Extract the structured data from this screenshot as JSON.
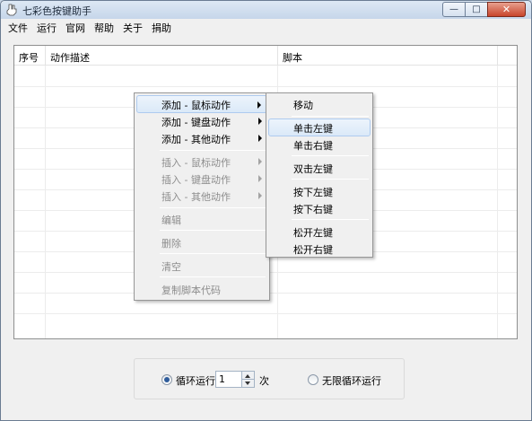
{
  "window": {
    "title": "七彩色按键助手",
    "controls": {
      "minimize": "—",
      "maximize": "□",
      "close": "✕"
    }
  },
  "menubar": [
    "文件",
    "运行",
    "官网",
    "帮助",
    "关于",
    "捐助"
  ],
  "grid": {
    "columns": [
      "序号",
      "动作描述",
      "脚本"
    ],
    "rows": []
  },
  "context_menu": {
    "items": [
      {
        "label": "添加 - 鼠标动作",
        "enabled": true,
        "submenu": true,
        "highlighted": true
      },
      {
        "label": "添加 - 键盘动作",
        "enabled": true,
        "submenu": true
      },
      {
        "label": "添加 - 其他动作",
        "enabled": true,
        "submenu": true
      },
      {
        "label": "插入 - 鼠标动作",
        "enabled": false,
        "submenu": true
      },
      {
        "label": "插入 - 键盘动作",
        "enabled": false,
        "submenu": true
      },
      {
        "label": "插入 - 其他动作",
        "enabled": false,
        "submenu": true
      },
      {
        "label": "编辑",
        "enabled": false
      },
      {
        "label": "删除",
        "enabled": false
      },
      {
        "label": "清空",
        "enabled": false
      },
      {
        "label": "复制脚本代码",
        "enabled": false
      }
    ]
  },
  "submenu": {
    "items": [
      {
        "label": "移动"
      },
      {
        "label": "单击左键",
        "highlighted": true
      },
      {
        "label": "单击右键"
      },
      {
        "label": "双击左键"
      },
      {
        "label": "按下左键"
      },
      {
        "label": "按下右键"
      },
      {
        "label": "松开左键"
      },
      {
        "label": "松开右键"
      }
    ]
  },
  "run_options": {
    "loop_label": "循环运行",
    "loop_count": "1",
    "loop_unit": "次",
    "infinite_label": "无限循环运行",
    "selected": "loop"
  },
  "colors": {
    "accent": "#2f5c9b",
    "close_button": "#c8452c",
    "highlight": "#dbe9f8"
  }
}
